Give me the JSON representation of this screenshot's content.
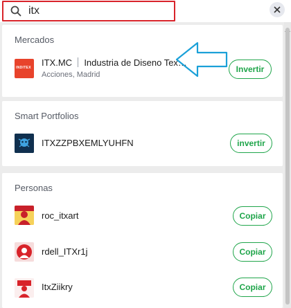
{
  "search": {
    "query": "itx"
  },
  "mercados": {
    "title": "Mercados",
    "item": {
      "symbol": "ITX.MC",
      "name": "Industria de Diseno Tex…",
      "type": "Acciones",
      "exchange": "Madrid",
      "button": "Invertir",
      "logo_text": "INDITEX"
    }
  },
  "smart": {
    "title": "Smart Portfolios",
    "item": {
      "name": "ITXZZPBXEMLYUHFN",
      "button": "invertir"
    }
  },
  "personas": {
    "title": "Personas",
    "items": [
      {
        "name": "roc_itxart",
        "button": "Copiar"
      },
      {
        "name": "rdell_ITXr1j",
        "button": "Copiar"
      },
      {
        "name": "ItxZiikry",
        "button": "Copiar"
      }
    ]
  },
  "colors": {
    "accent_green": "#1fa54a",
    "highlight_red": "#d8232a",
    "annotation_blue": "#1aa0d8"
  }
}
